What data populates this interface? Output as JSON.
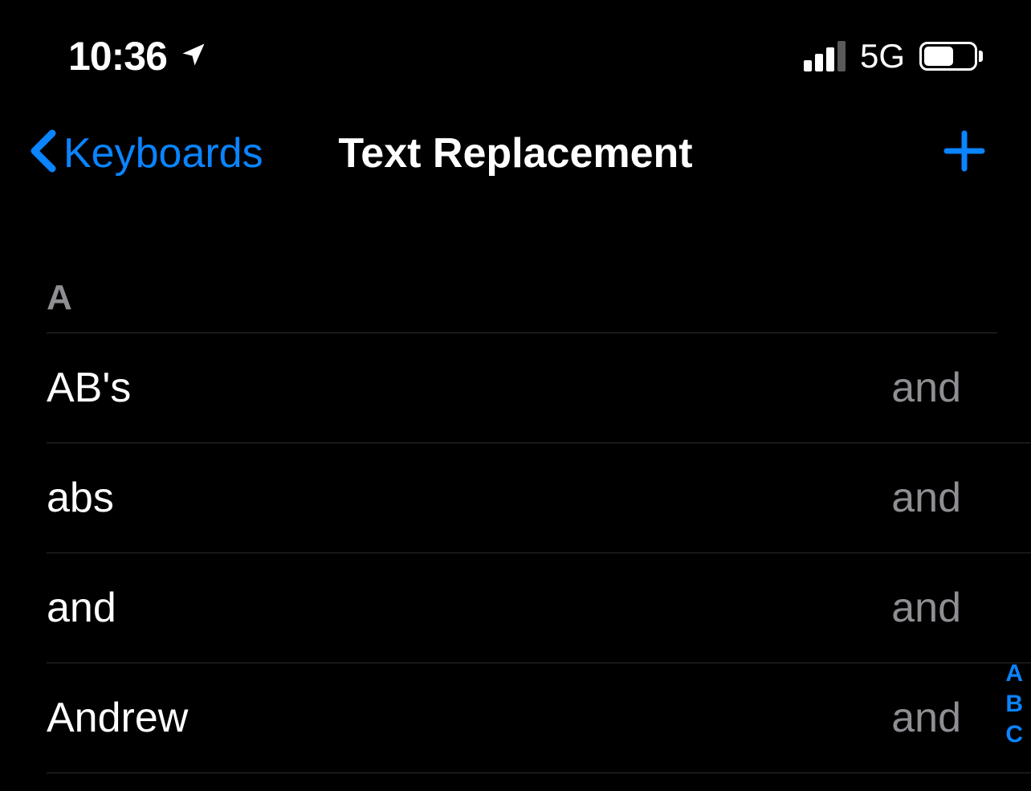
{
  "statusBar": {
    "time": "10:36",
    "network": "5G"
  },
  "nav": {
    "backLabel": "Keyboards",
    "title": "Text Replacement"
  },
  "section": {
    "header": "A"
  },
  "items": [
    {
      "phrase": "AB's",
      "shortcut": "and"
    },
    {
      "phrase": "abs",
      "shortcut": "and"
    },
    {
      "phrase": "and",
      "shortcut": "and"
    },
    {
      "phrase": "Andrew",
      "shortcut": "and"
    }
  ],
  "index": {
    "0": "A",
    "1": "B",
    "2": "C"
  }
}
